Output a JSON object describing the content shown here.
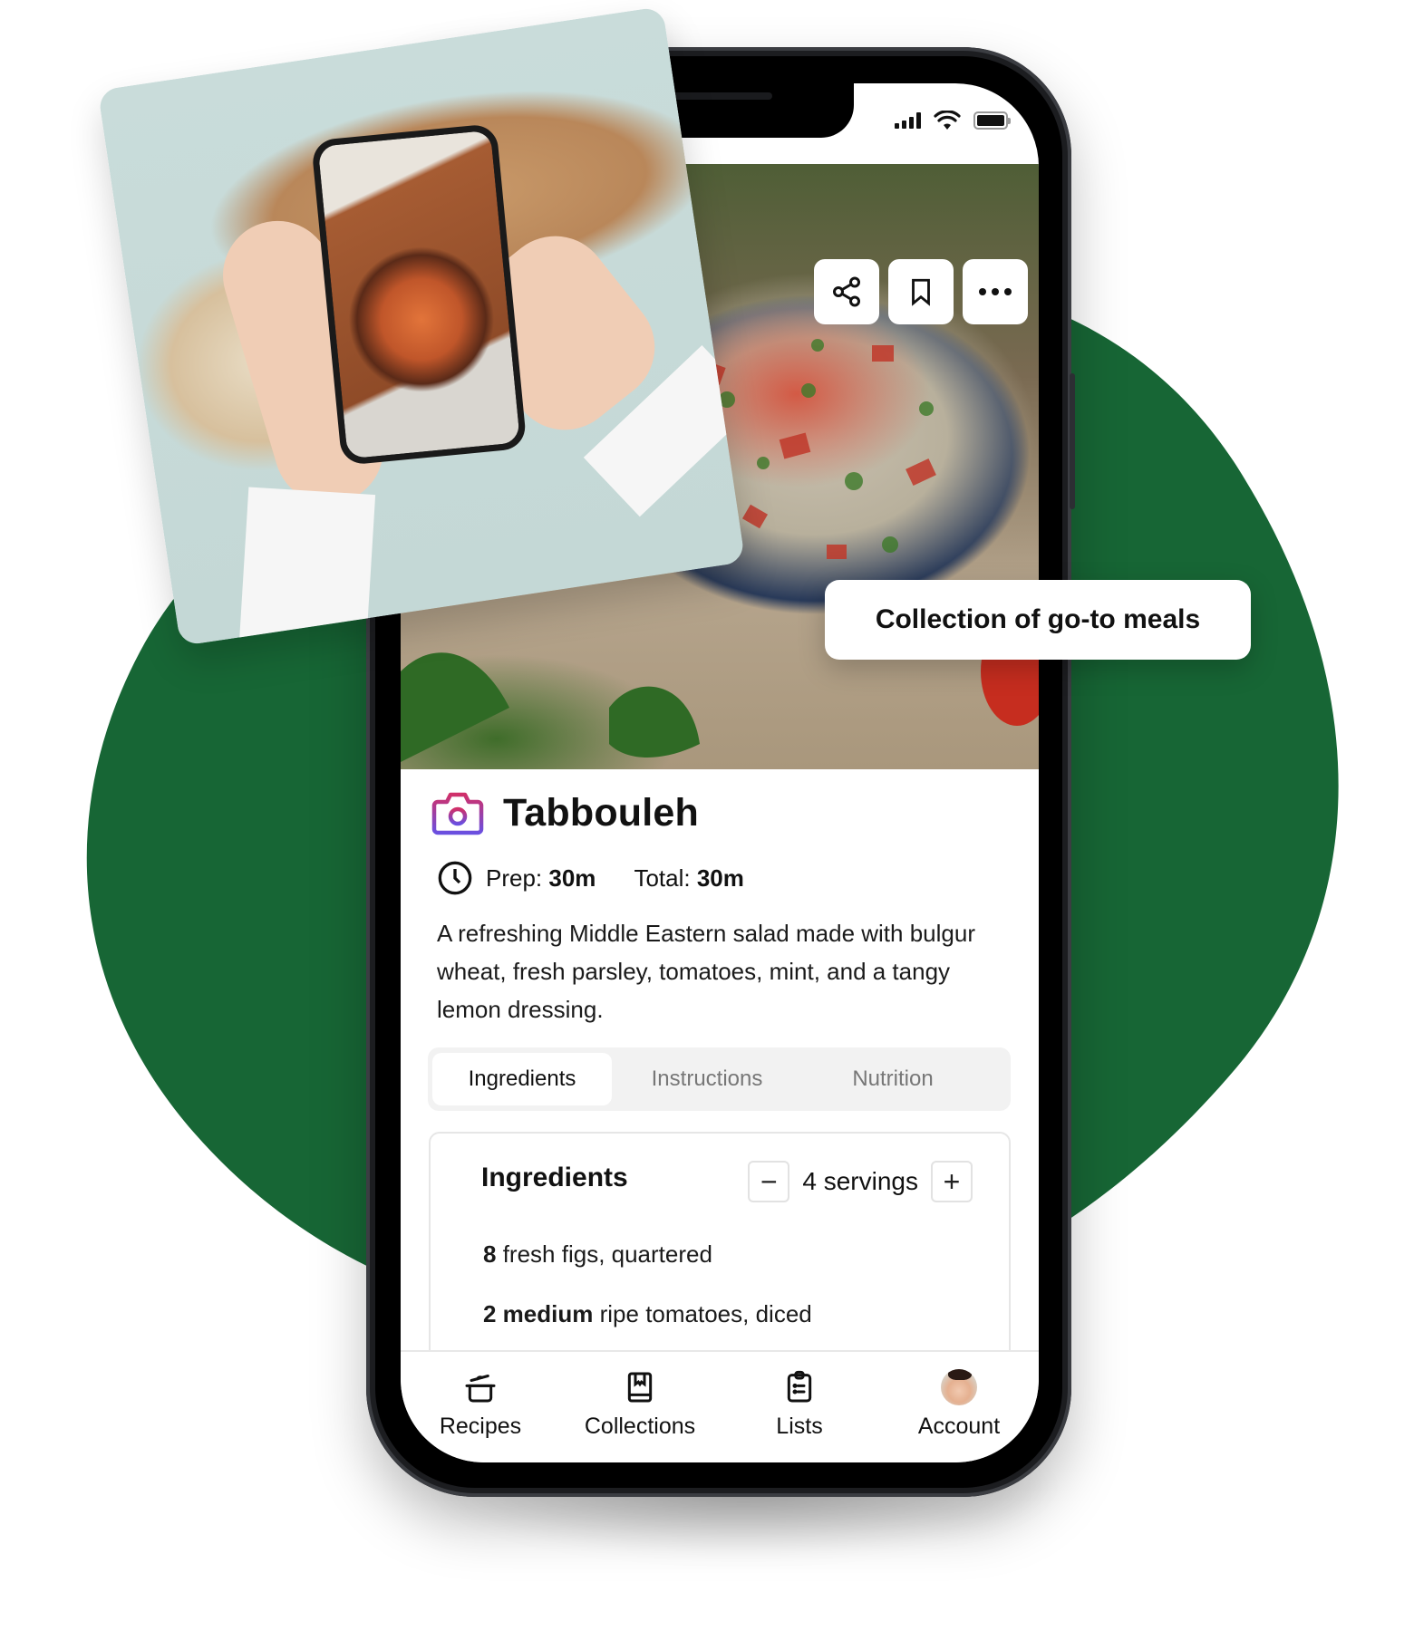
{
  "colors": {
    "blob_green": "#176635",
    "camera_gradient_start": "#d0306a",
    "camera_gradient_end": "#6a4fe0",
    "tab_bg": "#f2f2f2",
    "muted_text": "#777777"
  },
  "status_bar": {
    "signal_icon": "cellular-signal",
    "wifi_icon": "wifi",
    "battery_icon": "battery-full"
  },
  "hero": {
    "image_alt": "Bowl of tabbouleh salad",
    "actions": [
      {
        "icon": "share",
        "label": "Share"
      },
      {
        "icon": "bookmark",
        "label": "Save"
      },
      {
        "icon": "more",
        "label": "More"
      }
    ]
  },
  "recipe": {
    "source_icon": "camera",
    "title": "Tabbouleh",
    "prep_label": "Prep:",
    "prep_value": "30m",
    "total_label": "Total:",
    "total_value": "30m",
    "description": "A refreshing Middle Eastern salad made with bulgur wheat, fresh parsley, tomatoes, mint, and a tangy lemon dressing."
  },
  "tabs": [
    {
      "label": "Ingredients",
      "active": true
    },
    {
      "label": "Instructions",
      "active": false
    },
    {
      "label": "Nutrition",
      "active": false
    }
  ],
  "ingredients": {
    "heading": "Ingredients",
    "decrement_label": "−",
    "increment_label": "+",
    "servings": "4 servings",
    "items": [
      {
        "qty": "8",
        "text": "fresh figs, quartered"
      },
      {
        "qty": "2 medium",
        "text": "ripe tomatoes, diced"
      }
    ]
  },
  "tabbar": [
    {
      "label": "Recipes",
      "icon": "pot"
    },
    {
      "label": "Collections",
      "icon": "book"
    },
    {
      "label": "Lists",
      "icon": "clipboard"
    },
    {
      "label": "Account",
      "icon": "avatar"
    }
  ],
  "callout": {
    "text": "Collection of go-to meals"
  },
  "photo_card": {
    "alt": "Hands photographing a dish of figs and tomatoes with a phone"
  }
}
